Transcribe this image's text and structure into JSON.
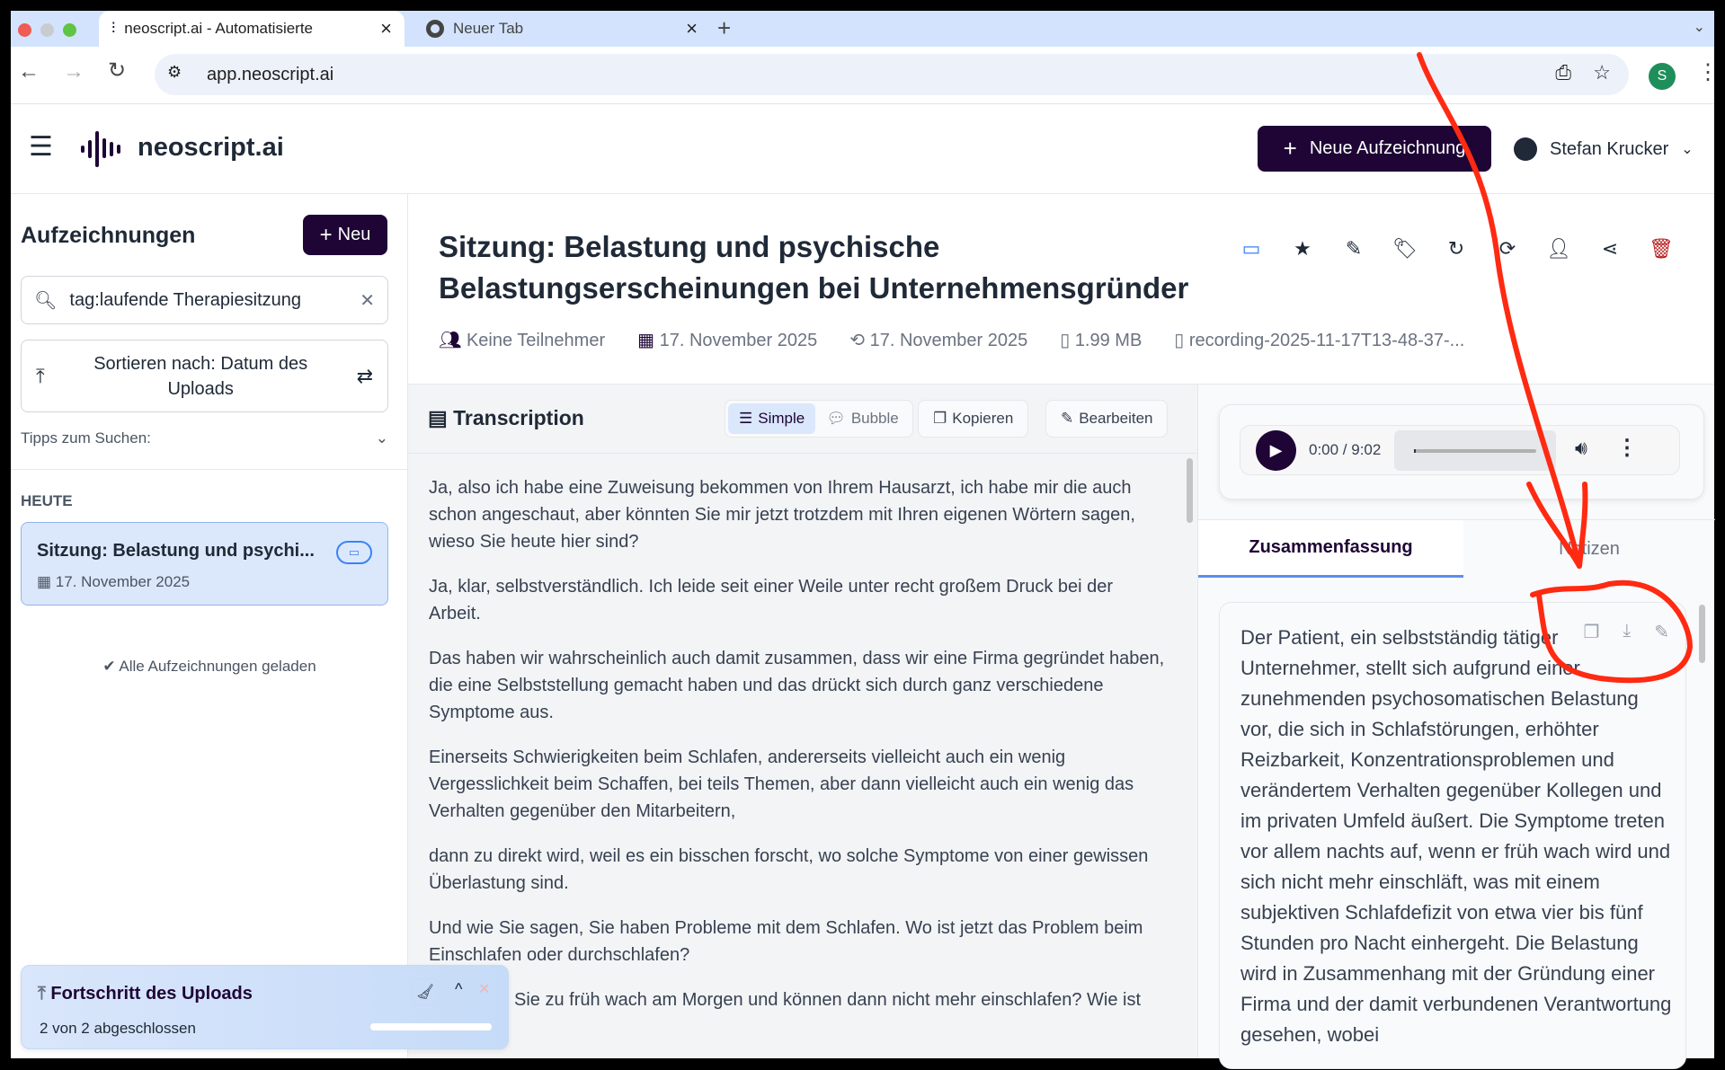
{
  "browser": {
    "tabs": [
      {
        "title": "neoscript.ai - Automatisierte",
        "close": "×"
      },
      {
        "title": "Neuer Tab",
        "close": "×"
      }
    ],
    "new_tab": "+",
    "url": "app.neoscript.ai",
    "profile_initial": "S"
  },
  "header": {
    "brand": "neoscript.ai",
    "new_recording": "Neue Aufzeichnung",
    "user": "Stefan Krucker"
  },
  "sidebar": {
    "title": "Aufzeichnungen",
    "new_button": "Neu",
    "search_value": "tag:laufende Therapiesitzung",
    "sort_label": "Sortieren nach: Datum des Uploads",
    "tips": "Tipps zum Suchen:",
    "group": "HEUTE",
    "items": [
      {
        "title": "Sitzung: Belastung und psychi...",
        "date": "17. November 2025"
      }
    ],
    "loaded": "Alle Aufzeichnungen geladen"
  },
  "recording": {
    "title": "Sitzung: Belastung und psychische Belastungserscheinungen bei Unternehmensgründer",
    "participants": "Keine Teilnehmer",
    "date": "17. November 2025",
    "modified": "17. November 2025",
    "size": "1.99 MB",
    "file": "recording-2025-11-17T13-48-37-..."
  },
  "transcription": {
    "title": "Transcription",
    "view_simple": "Simple",
    "view_bubble": "Bubble",
    "copy": "Kopieren",
    "edit": "Bearbeiten",
    "paragraphs": [
      "Ja, also ich habe eine Zuweisung bekommen von Ihrem Hausarzt, ich habe mir die auch schon angeschaut, aber könnten Sie mir jetzt trotzdem mit Ihren eigenen Wörtern sagen, wieso Sie heute hier sind?",
      "Ja, klar, selbstverständlich. Ich leide seit einer Weile unter recht großem Druck bei der Arbeit.",
      "Das haben wir wahrscheinlich auch damit zusammen, dass wir eine Firma gegründet haben, die eine Selbststellung gemacht haben und das drückt sich durch ganz verschiedene Symptome aus.",
      "Einerseits Schwierigkeiten beim Schlafen, andererseits vielleicht auch ein wenig Vergesslichkeit beim Schaffen, bei teils Themen, aber dann vielleicht auch ein wenig das Verhalten gegenüber den Mitarbeitern,",
      "dann zu direkt wird, weil es ein bisschen forscht, wo solche Symptome von einer gewissen Überlastung sind.",
      "Und wie Sie sagen, Sie haben Probleme mit dem Schlafen. Wo ist jetzt das Problem beim Einschlafen oder durchschlafen?",
      "Sie zu früh wach am Morgen und können dann nicht mehr einschlafen? Wie ist"
    ]
  },
  "player": {
    "time": "0:00 / 9:02",
    "progress": 0
  },
  "tabs": {
    "summary": "Zusammenfassung",
    "notes": "Notizen"
  },
  "summary": {
    "text": "Der Patient, ein selbstständig tätiger Unternehmer, stellt sich aufgrund einer zunehmenden psychosomatischen Belastung vor, die sich in Schlafstörungen, erhöhter Reizbarkeit, Konzentrationsproblemen und verändertem Verhalten gegenüber Kollegen und im privaten Umfeld äußert. Die Symptome treten vor allem nachts auf, wenn er früh wach wird und sich nicht mehr einschläft, was mit einem subjektiven Schlafdefizit von etwa vier bis fünf Stunden pro Nacht einhergeht. Die Belastung wird in Zusammenhang mit der Gründung einer Firma und der damit verbundenen Verantwortung gesehen, wobei"
  },
  "upload": {
    "title": "Fortschritt des Uploads",
    "status": "2 von 2 abgeschlossen",
    "progress": 1.0
  },
  "colors": {
    "brand": "#1e0535",
    "accent": "#3b82f6",
    "annotation": "#ff2a12",
    "delete": "#b91c1c"
  }
}
